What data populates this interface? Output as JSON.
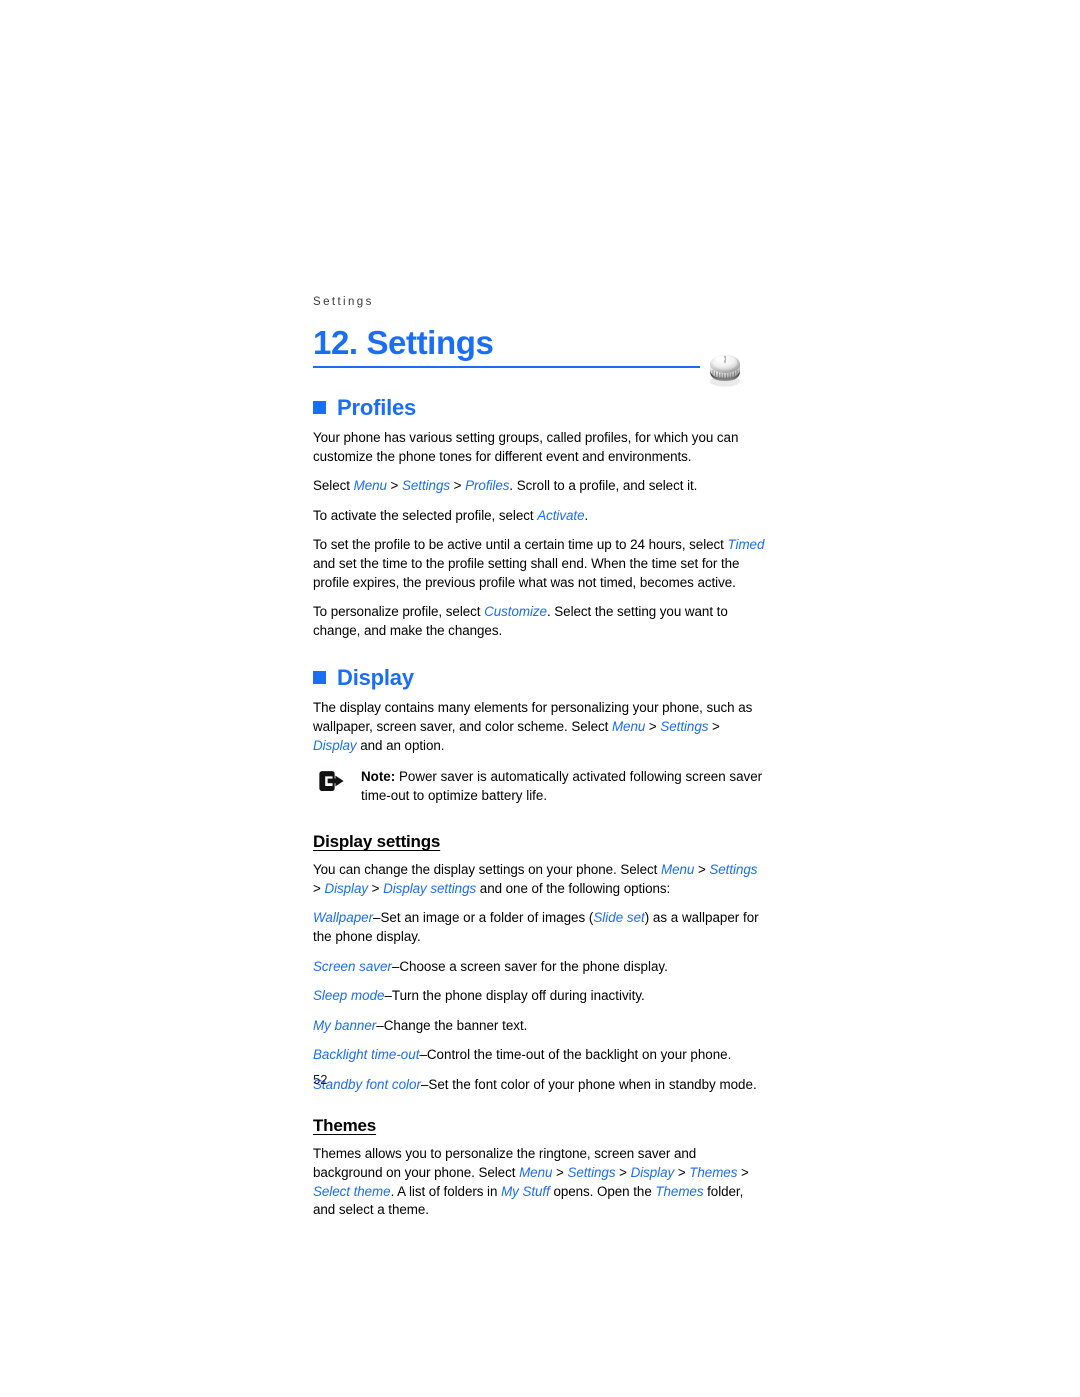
{
  "document": {
    "running_header": "Settings",
    "chapter_title": "12. Settings",
    "page_number": "52",
    "accent_color": "#1a6ef5",
    "knob_icon": "volume-knob-photo"
  },
  "profiles": {
    "heading": "Profiles",
    "bullet_icon": "square-bullet-icon",
    "p1": "Your phone has various setting groups, called profiles, for which you can customize the phone tones for different event and environments.",
    "p2_pre": "Select ",
    "p2_menu": "Menu",
    "p2_s1": " > ",
    "p2_settings": "Settings",
    "p2_s2": " > ",
    "p2_profiles": "Profiles",
    "p2_post": ". Scroll to a profile, and select it.",
    "p3_pre": "To activate the selected profile, select ",
    "p3_activate": "Activate",
    "p3_post": ".",
    "p4_pre": "To set the profile to be active until a certain time up to 24 hours, select ",
    "p4_timed": "Timed",
    "p4_post": " and set the time to the profile setting shall end. When the time set for the profile expires, the previous profile what was not timed, becomes active.",
    "p5_pre": "To personalize profile, select ",
    "p5_customize": "Customize",
    "p5_post": ". Select the setting you want to change, and make the changes."
  },
  "display": {
    "heading": "Display",
    "bullet_icon": "square-bullet-icon",
    "p1_pre": "The display contains many elements for personalizing your phone, such as wallpaper, screen saver, and color scheme. Select ",
    "p1_menu": "Menu",
    "p1_s1": " > ",
    "p1_settings": "Settings",
    "p1_s2": " > ",
    "p1_display": "Display",
    "p1_post": " and an option.",
    "note": {
      "icon": "note-arrow-icon",
      "label": "Note:",
      "text": " Power saver is automatically activated following screen saver time-out to optimize battery life."
    },
    "settings_subhead": "Display settings",
    "s_p1_pre": "You can change the display settings on your phone. Select ",
    "s_p1_menu": "Menu",
    "s_p1_s1": " > ",
    "s_p1_settings": "Settings",
    "s_p1_s2": " > ",
    "s_p1_display": "Display",
    "s_p1_s3": " > ",
    "s_p1_displaysettings": "Display settings",
    "s_p1_post": " and one of the following options:",
    "options": [
      {
        "term": "Wallpaper",
        "dash": "–",
        "desc_pre": "Set an image or a folder of images (",
        "inline_term": "Slide set",
        "desc_post": ") as a wallpaper for the phone display."
      },
      {
        "term": "Screen saver",
        "dash": "–",
        "desc_pre": "Choose a screen saver for the phone display.",
        "inline_term": "",
        "desc_post": ""
      },
      {
        "term": "Sleep mode",
        "dash": "–",
        "desc_pre": "Turn the phone display off during inactivity.",
        "inline_term": "",
        "desc_post": ""
      },
      {
        "term": "My banner",
        "dash": "–",
        "desc_pre": "Change the banner text.",
        "inline_term": "",
        "desc_post": ""
      },
      {
        "term": "Backlight time-out",
        "dash": "–",
        "desc_pre": "Control the time-out of the backlight on your phone.",
        "inline_term": "",
        "desc_post": ""
      },
      {
        "term": "Standby font color",
        "dash": "–",
        "desc_pre": "Set the font color of your phone when in standby mode.",
        "inline_term": "",
        "desc_post": ""
      }
    ]
  },
  "themes": {
    "subhead": "Themes",
    "p1_pre": "Themes allows you to personalize the ringtone, screen saver and background on your phone. Select ",
    "p1_menu": "Menu",
    "p1_s1": " > ",
    "p1_settings": "Settings",
    "p1_s2": " > ",
    "p1_display": "Display",
    "p1_s3": " > ",
    "p1_themes": "Themes",
    "p1_s4": " > ",
    "p1_selecttheme": "Select theme",
    "p1_mid": ". A list of folders in ",
    "p1_mystuff": "My Stuff",
    "p1_mid2": " opens. Open the ",
    "p1_themes2": "Themes",
    "p1_post": " folder, and select a theme."
  }
}
